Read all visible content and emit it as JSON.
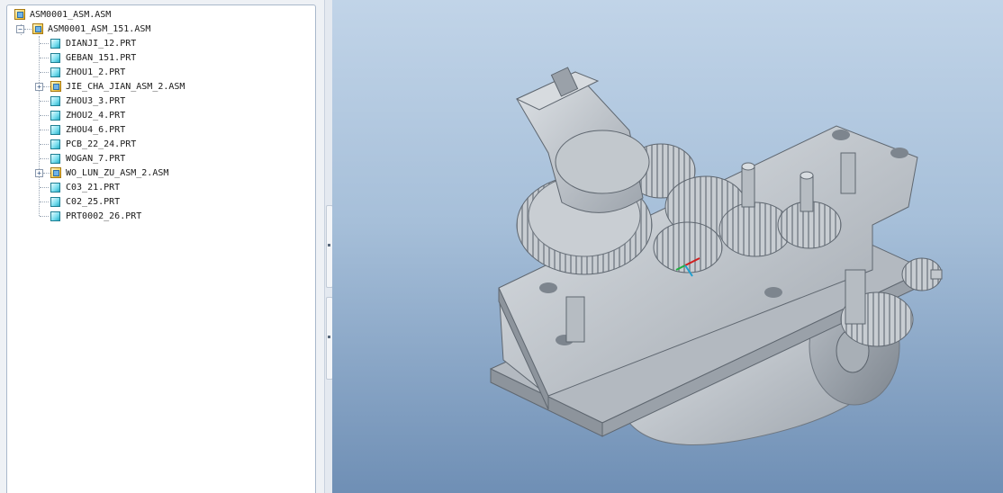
{
  "model_tree": {
    "items": [
      {
        "label": "ASM0001_ASM.ASM",
        "type": "asm",
        "level": 0,
        "expander": ""
      },
      {
        "label": "ASM0001_ASM_151.ASM",
        "type": "asm",
        "level": 1,
        "expander": "−"
      },
      {
        "label": "DIANJI_12.PRT",
        "type": "prt",
        "level": 2,
        "expander": ""
      },
      {
        "label": "GEBAN_151.PRT",
        "type": "prt",
        "level": 2,
        "expander": ""
      },
      {
        "label": "ZHOU1_2.PRT",
        "type": "prt",
        "level": 2,
        "expander": ""
      },
      {
        "label": "JIE_CHA_JIAN_ASM_2.ASM",
        "type": "asm",
        "level": 2,
        "expander": "+"
      },
      {
        "label": "ZHOU3_3.PRT",
        "type": "prt",
        "level": 2,
        "expander": ""
      },
      {
        "label": "ZHOU2_4.PRT",
        "type": "prt",
        "level": 2,
        "expander": ""
      },
      {
        "label": "ZHOU4_6.PRT",
        "type": "prt",
        "level": 2,
        "expander": ""
      },
      {
        "label": "PCB_22_24.PRT",
        "type": "prt",
        "level": 2,
        "expander": ""
      },
      {
        "label": "WOGAN_7.PRT",
        "type": "prt",
        "level": 2,
        "expander": ""
      },
      {
        "label": "WO_LUN_ZU_ASM_2.ASM",
        "type": "asm",
        "level": 2,
        "expander": "+"
      },
      {
        "label": "C03_21.PRT",
        "type": "prt",
        "level": 2,
        "expander": ""
      },
      {
        "label": "C02_25.PRT",
        "type": "prt",
        "level": 2,
        "expander": ""
      },
      {
        "label": "PRT0002_26.PRT",
        "type": "prt",
        "level": 2,
        "expander": ""
      }
    ]
  },
  "viewport": {
    "model_name": "gearbox-assembly",
    "colors": {
      "background_top": "#c1d4e8",
      "background_bottom": "#6f8fb5",
      "part": "#b9bec4"
    }
  }
}
